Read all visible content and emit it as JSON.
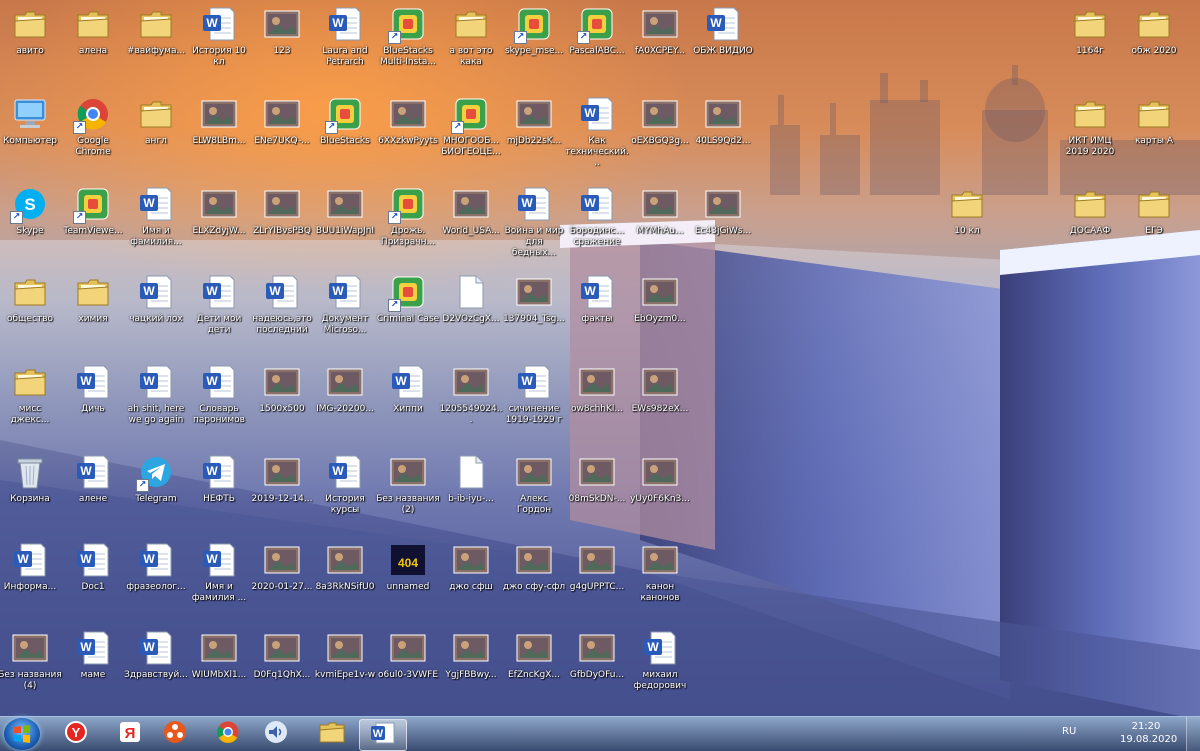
{
  "desktop": {
    "icons": [
      {
        "label": "авито",
        "type": "folder"
      },
      {
        "label": "алена",
        "type": "folder"
      },
      {
        "label": "#вайфума...",
        "type": "folder"
      },
      {
        "label": "История 10 кл",
        "type": "word"
      },
      {
        "label": "123",
        "type": "image"
      },
      {
        "label": "Laura and Petrarch",
        "type": "word"
      },
      {
        "label": "BlueStacks Multi-Insta...",
        "type": "app"
      },
      {
        "label": "а вот это кака",
        "type": "folder"
      },
      {
        "label": "skype_mse...",
        "type": "app"
      },
      {
        "label": "PascalABC...",
        "type": "app"
      },
      {
        "label": "fA0XCPEY...",
        "type": "image"
      },
      {
        "label": "ОБЖ ВИДИО",
        "type": "word"
      },
      {
        "label": "1164г",
        "type": "folder"
      },
      {
        "label": "обж 2020",
        "type": "folder"
      },
      {
        "label": "Компьютер",
        "type": "computer"
      },
      {
        "label": "Google Chrome",
        "type": "chrome"
      },
      {
        "label": "англ",
        "type": "folder"
      },
      {
        "label": "ELW8LBm...",
        "type": "image"
      },
      {
        "label": "ENe7UKQ-...",
        "type": "image"
      },
      {
        "label": "BlueStacks",
        "type": "app"
      },
      {
        "label": "6XXzkwPyyts",
        "type": "image"
      },
      {
        "label": "МНОГООБ... БИОГЕОЦЕ...",
        "type": "app"
      },
      {
        "label": "mjDb22sK...",
        "type": "image"
      },
      {
        "label": "Как технический...",
        "type": "word"
      },
      {
        "label": "oEXBGQ3g...",
        "type": "image"
      },
      {
        "label": "40LS9Qd2...",
        "type": "image"
      },
      {
        "label": "ИКТ ИМЦ 2019 2020",
        "type": "folder"
      },
      {
        "label": "карты А",
        "type": "folder"
      },
      {
        "label": "Skype",
        "type": "skype"
      },
      {
        "label": "TeamViewe...",
        "type": "app"
      },
      {
        "label": "Имя и фамилия...",
        "type": "word"
      },
      {
        "label": "ELXZdyjW...",
        "type": "image"
      },
      {
        "label": "ZLrYIBvsPBQ",
        "type": "image"
      },
      {
        "label": "BUU1iWapJnI",
        "type": "image"
      },
      {
        "label": "Дрожь. Призрачн...",
        "type": "app"
      },
      {
        "label": "World_USA...",
        "type": "image"
      },
      {
        "label": "Война и мир для бедных...",
        "type": "word"
      },
      {
        "label": "Бородинс... сражение",
        "type": "word"
      },
      {
        "label": "MYMhAu...",
        "type": "image"
      },
      {
        "label": "Ec43jGiWs...",
        "type": "image"
      },
      {
        "label": "10 кл",
        "type": "folder"
      },
      {
        "label": "ДОСААФ",
        "type": "folder"
      },
      {
        "label": "ЕГЭ",
        "type": "folder"
      },
      {
        "label": "общество",
        "type": "folder"
      },
      {
        "label": "химия",
        "type": "folder"
      },
      {
        "label": "чацкий лох",
        "type": "word"
      },
      {
        "label": "Дети мои дети",
        "type": "word"
      },
      {
        "label": "надеюсь,это последний",
        "type": "word"
      },
      {
        "label": "Документ Microso...",
        "type": "word"
      },
      {
        "label": "Criminal Case",
        "type": "app"
      },
      {
        "label": "D2VOzCgX...",
        "type": "file"
      },
      {
        "label": "137904_Tsg...",
        "type": "image"
      },
      {
        "label": "факты",
        "type": "word"
      },
      {
        "label": "EbOyzm0...",
        "type": "image"
      },
      {
        "label": "мисс джекс...",
        "type": "folder"
      },
      {
        "label": "Дичь",
        "type": "word"
      },
      {
        "label": "ah shit, here we go again",
        "type": "word"
      },
      {
        "label": "Словарь паронимов",
        "type": "word"
      },
      {
        "label": "1500x500",
        "type": "image"
      },
      {
        "label": "IMG-20200...",
        "type": "image"
      },
      {
        "label": "Хиппи",
        "type": "word"
      },
      {
        "label": "1205549024...",
        "type": "image"
      },
      {
        "label": "сичинение 1919-1929 г",
        "type": "word"
      },
      {
        "label": "ow8chhKl...",
        "type": "image"
      },
      {
        "label": "EWs982eX...",
        "type": "image"
      },
      {
        "label": "Корзина",
        "type": "bin"
      },
      {
        "label": "алене",
        "type": "word"
      },
      {
        "label": "Telegram",
        "type": "telegram"
      },
      {
        "label": "НЕФТЬ",
        "type": "word"
      },
      {
        "label": "2019-12-14...",
        "type": "image"
      },
      {
        "label": "История курсы",
        "type": "word"
      },
      {
        "label": "Без названия (2)",
        "type": "image"
      },
      {
        "label": "b-ib-iyu-...",
        "type": "file"
      },
      {
        "label": "Алекс Гордон",
        "type": "image"
      },
      {
        "label": "08mSkDN-...",
        "type": "image"
      },
      {
        "label": "yUy0F6Kn3...",
        "type": "image"
      },
      {
        "label": "Информа...",
        "type": "word"
      },
      {
        "label": "Doc1",
        "type": "word"
      },
      {
        "label": "фразеолог...",
        "type": "word"
      },
      {
        "label": "Имя и фамилия ...",
        "type": "word"
      },
      {
        "label": "2020-01-27...",
        "type": "image"
      },
      {
        "label": "8a3RkNSifU0",
        "type": "image"
      },
      {
        "label": "unnamed",
        "type": "404"
      },
      {
        "label": "джо сфш",
        "type": "image"
      },
      {
        "label": "джо сфу-сфл",
        "type": "image"
      },
      {
        "label": "g4gUPPTC...",
        "type": "image"
      },
      {
        "label": "канон канонов",
        "type": "image"
      },
      {
        "label": "Без названия (4)",
        "type": "image"
      },
      {
        "label": "маме",
        "type": "word"
      },
      {
        "label": "Здравствуй...",
        "type": "word"
      },
      {
        "label": "WIUMbXl1...",
        "type": "image"
      },
      {
        "label": "D0Fq1QhX...",
        "type": "image"
      },
      {
        "label": "kvmiEpe1v-w",
        "type": "image"
      },
      {
        "label": "o6ul0-3VWFE",
        "type": "image"
      },
      {
        "label": "YgjFBBwy...",
        "type": "image"
      },
      {
        "label": "EfZncKgX...",
        "type": "image"
      },
      {
        "label": "GfbDyOFu...",
        "type": "image"
      },
      {
        "label": "михаил федорович",
        "type": "word"
      }
    ]
  },
  "taskbar": {
    "pinned": [
      {
        "name": "yandex-browser-icon",
        "active": false
      },
      {
        "name": "yandex-icon",
        "active": false
      },
      {
        "name": "media-player-icon",
        "active": false
      },
      {
        "name": "chrome-icon",
        "active": false
      },
      {
        "name": "speaker-app-icon",
        "active": false
      },
      {
        "name": "file-explorer-icon",
        "active": false
      },
      {
        "name": "word-icon",
        "active": true
      }
    ],
    "language": "RU",
    "time": "21:20",
    "date": "19.08.2020"
  }
}
